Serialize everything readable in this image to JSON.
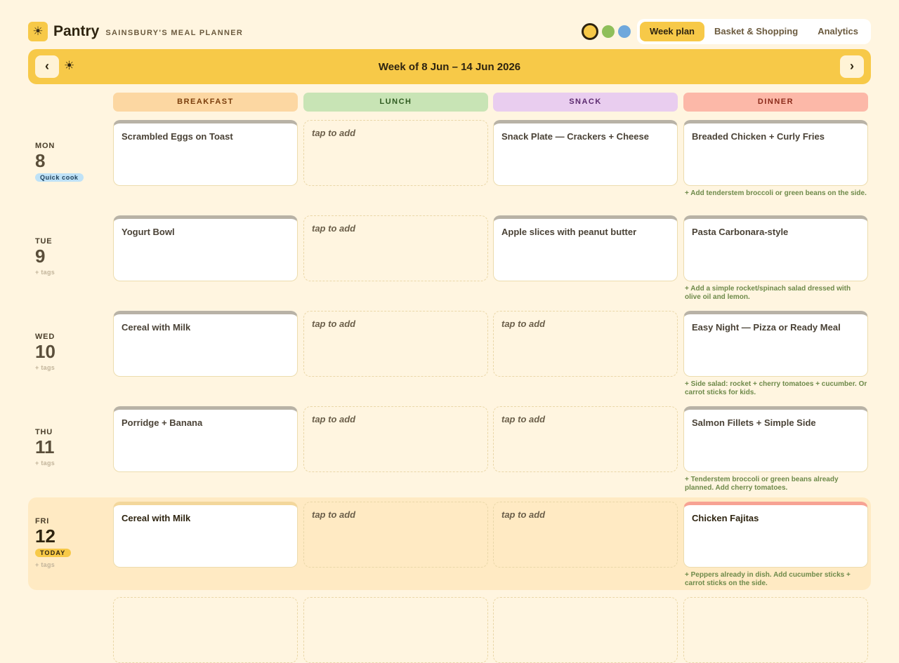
{
  "app": {
    "logo_glyph": "☀",
    "name": "Pantry",
    "subtitle": "SAINSBURY'S MEAL PLANNER"
  },
  "theme_dots": [
    {
      "color": "#f7c948",
      "selected": true
    },
    {
      "color": "#8fbf5a",
      "selected": false
    },
    {
      "color": "#6fa8dc",
      "selected": false
    }
  ],
  "tabs": [
    {
      "label": "Week plan",
      "active": true
    },
    {
      "label": "Basket & Shopping",
      "active": false
    },
    {
      "label": "Analytics",
      "active": false
    }
  ],
  "week": {
    "prev_label": "‹",
    "next_label": "›",
    "sun_glyph": "☀",
    "title": "Week of 8 Jun – 14 Jun 2026"
  },
  "columns": [
    {
      "label": "BREAKFAST",
      "bg": "#fcd7a2",
      "color": "#7a3e0c"
    },
    {
      "label": "LUNCH",
      "bg": "#c8e4b5",
      "color": "#2f5a20"
    },
    {
      "label": "SNACK",
      "bg": "#e9cdef",
      "color": "#5b2a6e"
    },
    {
      "label": "DINNER",
      "bg": "#fcb8a8",
      "color": "#8a2a1a"
    }
  ],
  "empty_label": "tap to add",
  "days": [
    {
      "dow": "MON",
      "num": "8",
      "badge": "Quick cook",
      "meals": [
        "Scrambled Eggs on Toast",
        "",
        "Snack Plate — Crackers + Cheese",
        "Breaded Chicken + Curly Fries"
      ],
      "note": "+ Add tenderstem broccoli or green beans on the side."
    },
    {
      "dow": "TUE",
      "num": "9",
      "tags": "+ tags",
      "meals": [
        "Yogurt Bowl",
        "",
        "Apple slices with peanut butter",
        "Pasta Carbonara-style"
      ],
      "note": "+ Add a simple rocket/spinach salad dressed with olive oil and lemon."
    },
    {
      "dow": "WED",
      "num": "10",
      "tags": "+ tags",
      "meals": [
        "Cereal with Milk",
        "",
        "",
        "Easy Night — Pizza or Ready Meal"
      ],
      "note": "+ Side salad: rocket + cherry tomatoes + cucumber. Or carrot sticks for kids."
    },
    {
      "dow": "THU",
      "num": "11",
      "tags": "+ tags",
      "meals": [
        "Porridge + Banana",
        "",
        "",
        "Salmon Fillets + Simple Side"
      ],
      "note": "+ Tenderstem broccoli or green beans already planned. Add cherry tomatoes."
    },
    {
      "dow": "FRI",
      "num": "12",
      "today_badge": "TODAY",
      "tags": "+ tags",
      "meals": [
        "Cereal with Milk",
        "",
        "",
        "Chicken Fajitas"
      ],
      "note": "+ Peppers already in dish. Add cucumber sticks + carrot sticks on the side."
    }
  ]
}
